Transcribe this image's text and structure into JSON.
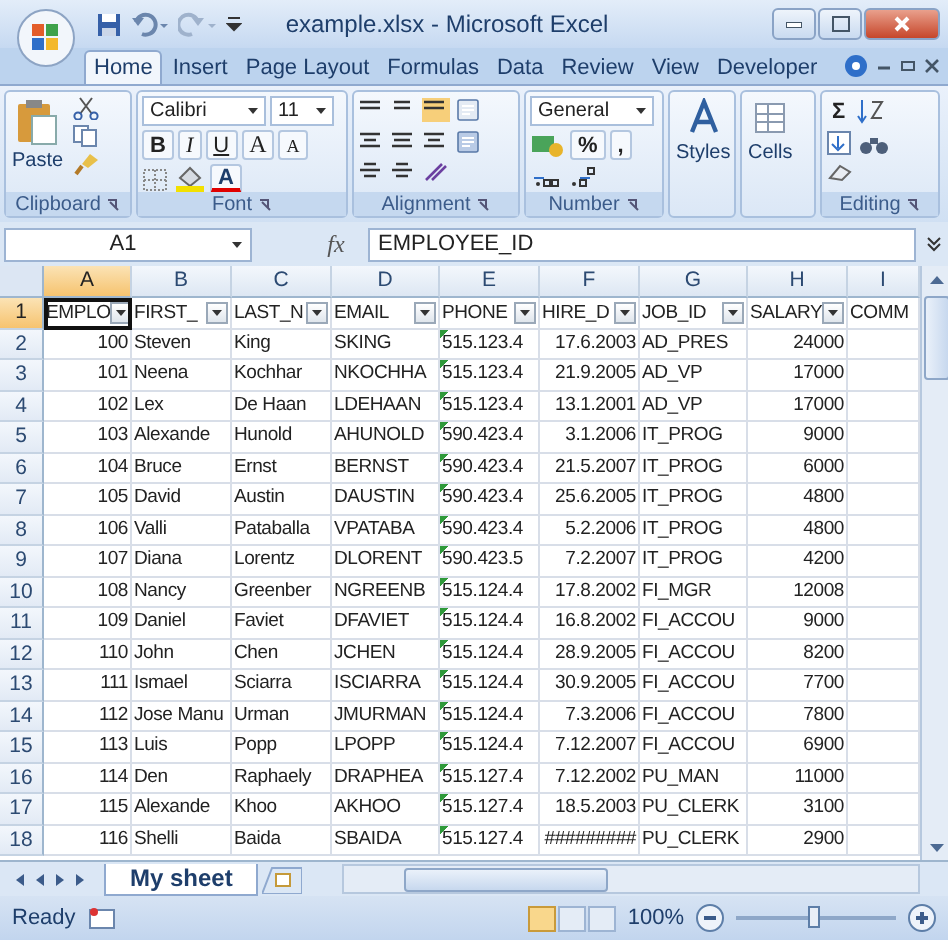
{
  "window": {
    "title": "example.xlsx - Microsoft Excel"
  },
  "tabs": [
    {
      "label": "Home",
      "selected": true
    },
    {
      "label": "Insert",
      "selected": false
    },
    {
      "label": "Page Layout",
      "selected": false
    },
    {
      "label": "Formulas",
      "selected": false
    },
    {
      "label": "Data",
      "selected": false
    },
    {
      "label": "Review",
      "selected": false
    },
    {
      "label": "View",
      "selected": false
    },
    {
      "label": "Developer",
      "selected": false
    }
  ],
  "ribbon": {
    "paste": "Paste",
    "font": "Calibri",
    "font_size": "11",
    "font_buttons": [
      "B",
      "I",
      "U"
    ],
    "grow_buttons": [
      "A",
      "A"
    ],
    "font_color": "A",
    "number_format": "General",
    "number_buttons": [
      "%",
      ","
    ],
    "styles": "Styles",
    "cells": "Cells",
    "sum": "Σ",
    "groups": [
      {
        "label": "Clipboard"
      },
      {
        "label": "Font"
      },
      {
        "label": "Alignment"
      },
      {
        "label": "Number"
      },
      {
        "label": "Editing"
      }
    ]
  },
  "formula_bar": {
    "name_box": "A1",
    "fx": "fx",
    "value": "EMPLOYEE_ID"
  },
  "columns": [
    {
      "letter": "A",
      "header": "EMPLO",
      "filter": true,
      "kind": "number",
      "selected": true
    },
    {
      "letter": "B",
      "header": "FIRST_",
      "filter": true,
      "kind": "text",
      "selected": false
    },
    {
      "letter": "C",
      "header": "LAST_N",
      "filter": true,
      "kind": "text",
      "selected": false
    },
    {
      "letter": "D",
      "header": "EMAIL",
      "filter": true,
      "kind": "text",
      "selected": false
    },
    {
      "letter": "E",
      "header": "PHONE",
      "filter": true,
      "kind": "text",
      "selected": false
    },
    {
      "letter": "F",
      "header": "HIRE_D",
      "filter": true,
      "kind": "number",
      "selected": false
    },
    {
      "letter": "G",
      "header": "JOB_ID",
      "filter": true,
      "kind": "text",
      "selected": false
    },
    {
      "letter": "H",
      "header": "SALARY",
      "filter": true,
      "kind": "number",
      "selected": false
    },
    {
      "letter": "I",
      "header": "COMM",
      "filter": false,
      "kind": "text",
      "selected": false
    }
  ],
  "rows": [
    {
      "number": "2",
      "selected": false,
      "phone_flag": true,
      "cells": [
        "100",
        "Steven",
        "King",
        "SKING",
        "515.123.4",
        "17.6.2003",
        "AD_PRES",
        "24000"
      ]
    },
    {
      "number": "3",
      "selected": false,
      "phone_flag": true,
      "cells": [
        "101",
        "Neena",
        "Kochhar",
        "NKOCHHA",
        "515.123.4",
        "21.9.2005",
        "AD_VP",
        "17000"
      ]
    },
    {
      "number": "4",
      "selected": false,
      "phone_flag": true,
      "cells": [
        "102",
        "Lex",
        "De Haan",
        "LDEHAAN",
        "515.123.4",
        "13.1.2001",
        "AD_VP",
        "17000"
      ]
    },
    {
      "number": "5",
      "selected": false,
      "phone_flag": true,
      "cells": [
        "103",
        "Alexande",
        "Hunold",
        "AHUNOLD",
        "590.423.4",
        "3.1.2006",
        "IT_PROG",
        "9000"
      ]
    },
    {
      "number": "6",
      "selected": false,
      "phone_flag": true,
      "cells": [
        "104",
        "Bruce",
        "Ernst",
        "BERNST",
        "590.423.4",
        "21.5.2007",
        "IT_PROG",
        "6000"
      ]
    },
    {
      "number": "7",
      "selected": false,
      "phone_flag": true,
      "cells": [
        "105",
        "David",
        "Austin",
        "DAUSTIN",
        "590.423.4",
        "25.6.2005",
        "IT_PROG",
        "4800"
      ]
    },
    {
      "number": "8",
      "selected": false,
      "phone_flag": true,
      "cells": [
        "106",
        "Valli",
        "Pataballa",
        "VPATABA",
        "590.423.4",
        "5.2.2006",
        "IT_PROG",
        "4800"
      ]
    },
    {
      "number": "9",
      "selected": false,
      "phone_flag": true,
      "cells": [
        "107",
        "Diana",
        "Lorentz",
        "DLORENT",
        "590.423.5",
        "7.2.2007",
        "IT_PROG",
        "4200"
      ]
    },
    {
      "number": "10",
      "selected": false,
      "phone_flag": true,
      "cells": [
        "108",
        "Nancy",
        "Greenber",
        "NGREENB",
        "515.124.4",
        "17.8.2002",
        "FI_MGR",
        "12008"
      ]
    },
    {
      "number": "11",
      "selected": false,
      "phone_flag": true,
      "cells": [
        "109",
        "Daniel",
        "Faviet",
        "DFAVIET",
        "515.124.4",
        "16.8.2002",
        "FI_ACCOU",
        "9000"
      ]
    },
    {
      "number": "12",
      "selected": false,
      "phone_flag": true,
      "cells": [
        "110",
        "John",
        "Chen",
        "JCHEN",
        "515.124.4",
        "28.9.2005",
        "FI_ACCOU",
        "8200"
      ]
    },
    {
      "number": "13",
      "selected": false,
      "phone_flag": true,
      "cells": [
        "111",
        "Ismael",
        "Sciarra",
        "ISCIARRA",
        "515.124.4",
        "30.9.2005",
        "FI_ACCOU",
        "7700"
      ]
    },
    {
      "number": "14",
      "selected": false,
      "phone_flag": true,
      "cells": [
        "112",
        "Jose Manu",
        "Urman",
        "JMURMAN",
        "515.124.4",
        "7.3.2006",
        "FI_ACCOU",
        "7800"
      ]
    },
    {
      "number": "15",
      "selected": false,
      "phone_flag": true,
      "cells": [
        "113",
        "Luis",
        "Popp",
        "LPOPP",
        "515.124.4",
        "7.12.2007",
        "FI_ACCOU",
        "6900"
      ]
    },
    {
      "number": "16",
      "selected": false,
      "phone_flag": true,
      "cells": [
        "114",
        "Den",
        "Raphaely",
        "DRAPHEA",
        "515.127.4",
        "7.12.2002",
        "PU_MAN",
        "11000"
      ]
    },
    {
      "number": "17",
      "selected": false,
      "phone_flag": true,
      "cells": [
        "115",
        "Alexande",
        "Khoo",
        "AKHOO",
        "515.127.4",
        "18.5.2003",
        "PU_CLERK",
        "3100"
      ]
    },
    {
      "number": "18",
      "selected": false,
      "phone_flag": true,
      "cells": [
        "116",
        "Shelli",
        "Baida",
        "SBAIDA",
        "515.127.4",
        "#########",
        "PU_CLERK",
        "2900"
      ]
    }
  ],
  "header_row": {
    "number": "1",
    "selected": true
  },
  "sheets": [
    {
      "name": "My sheet",
      "selected": true
    }
  ],
  "status_bar": {
    "status": "Ready",
    "zoom": "100%",
    "zoom_slider": {
      "level": 0.5
    },
    "views": [
      {
        "selected": true
      },
      {
        "selected": false
      },
      {
        "selected": false
      }
    ]
  }
}
